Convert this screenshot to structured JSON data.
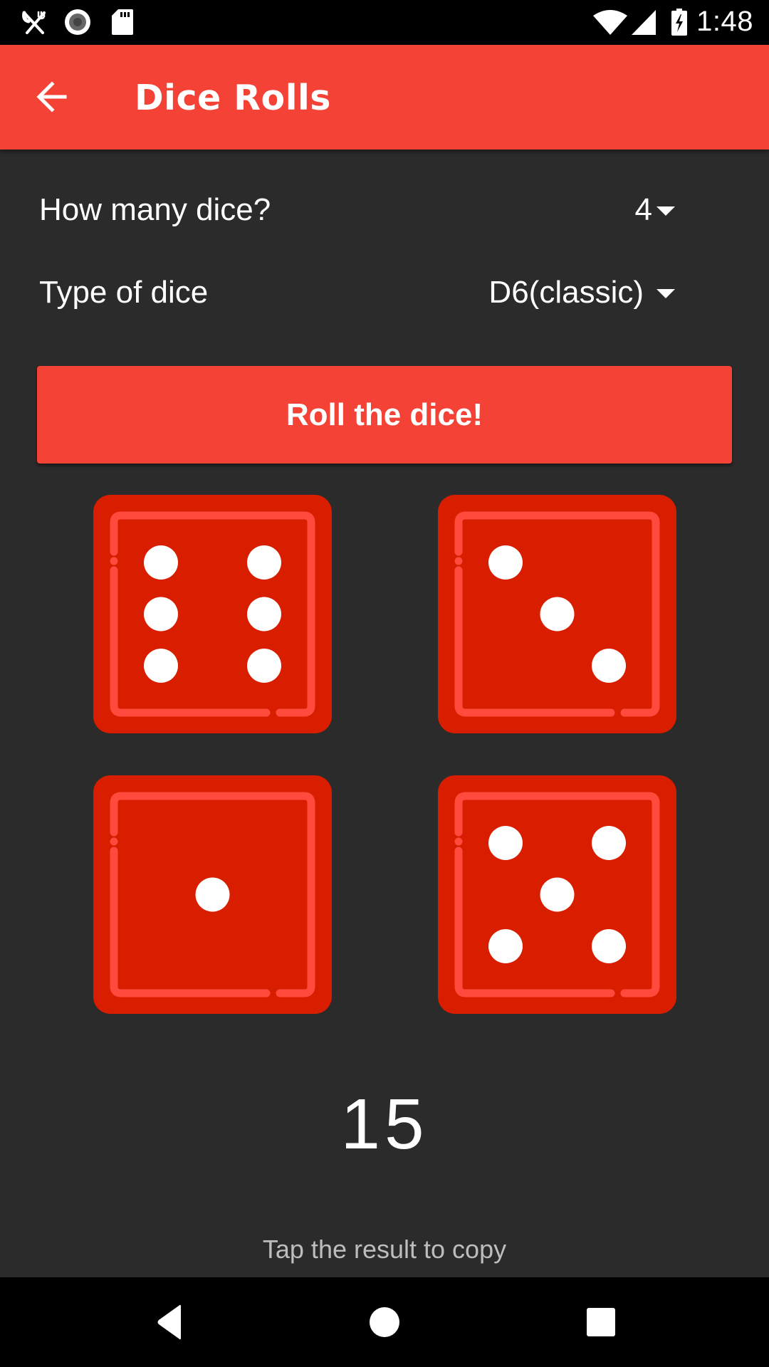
{
  "status_bar": {
    "time": "1:48",
    "left_icons": [
      "restaurant-icon",
      "record-icon",
      "sd-card-icon"
    ],
    "right_icons": [
      "wifi-icon",
      "cell-signal-icon",
      "battery-charging-icon"
    ]
  },
  "app_bar": {
    "title": "Dice Rolls",
    "back_icon": "arrow-back-icon"
  },
  "settings": {
    "dice_count": {
      "label": "How many dice?",
      "value": "4"
    },
    "dice_type": {
      "label": "Type of dice",
      "value": "D6(classic)"
    }
  },
  "roll_button": {
    "label": "Roll the dice!"
  },
  "dice": [
    {
      "value": 6
    },
    {
      "value": 3
    },
    {
      "value": 1
    },
    {
      "value": 5
    }
  ],
  "result": {
    "total": "15",
    "hint": "Tap the result to copy"
  },
  "colors": {
    "accent": "#f44336",
    "die_face": "#d91e00",
    "die_outline": "#ff4a3d",
    "pip": "#ffffff",
    "background": "#2b2b2b"
  },
  "nav_bar": {
    "buttons": [
      "back-nav-icon",
      "home-nav-icon",
      "recents-nav-icon"
    ]
  }
}
